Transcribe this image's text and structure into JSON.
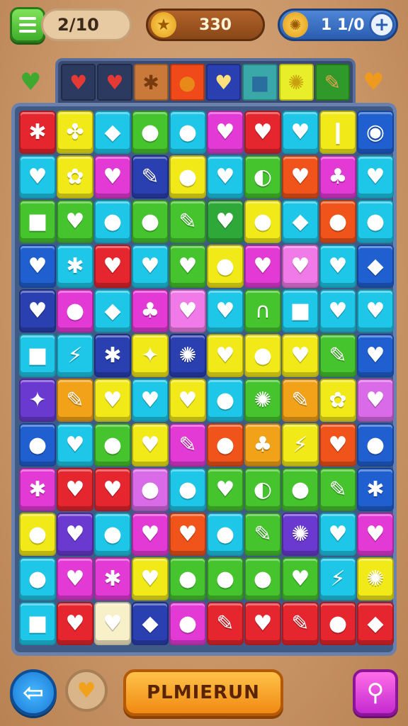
{
  "hud": {
    "moves": "2/10",
    "score": "330",
    "coins": "1 1/0",
    "star_glyph": "★",
    "coin_glyph": "✺",
    "plus_glyph": "+"
  },
  "goals": {
    "left_glyph": "♥",
    "right_glyph": "♥",
    "slots": [
      {
        "glyph": "♥",
        "bg": "#2b3a5e",
        "fg": "#e53935"
      },
      {
        "glyph": "♥",
        "bg": "#2b3a5e",
        "fg": "#e53935"
      },
      {
        "glyph": "✱",
        "bg": "#c97a3a",
        "fg": "#7a3a10"
      },
      {
        "glyph": "●",
        "bg": "#f04a1a",
        "fg": "#e88a1a"
      },
      {
        "glyph": "♥",
        "bg": "#2a3fb0",
        "fg": "#ffe07a"
      },
      {
        "glyph": "■",
        "bg": "#3aa8a8",
        "fg": "#2a6ea0"
      },
      {
        "glyph": "✺",
        "bg": "#e8ef2a",
        "fg": "#c8a010"
      },
      {
        "glyph": "✎",
        "bg": "#2f9a2a",
        "fg": "#e8a050"
      }
    ]
  },
  "board": {
    "rows": [
      [
        [
          "#e5262e",
          "✱"
        ],
        [
          "#f2ea18",
          "✤"
        ],
        [
          "#1ec7e8",
          "◆"
        ],
        [
          "#45c42e",
          "●"
        ],
        [
          "#1ec7e8",
          "●"
        ],
        [
          "#e33ad6",
          "♥"
        ],
        [
          "#e5262e",
          "♥"
        ],
        [
          "#1ec7e8",
          "♥"
        ],
        [
          "#f2ea18",
          "❙"
        ],
        [
          "#1f5fd0",
          "◉"
        ]
      ],
      [
        [
          "#1ec7e8",
          "♥"
        ],
        [
          "#f2ea18",
          "✿"
        ],
        [
          "#e33ad6",
          "♥"
        ],
        [
          "#2a3fb0",
          "✎"
        ],
        [
          "#f2ea18",
          "●"
        ],
        [
          "#1ec7e8",
          "♥"
        ],
        [
          "#45c42e",
          "◐"
        ],
        [
          "#f0541a",
          "♥"
        ],
        [
          "#e33ad6",
          "♣"
        ],
        [
          "#1ec7e8",
          "♥"
        ]
      ],
      [
        [
          "#45c42e",
          "■"
        ],
        [
          "#45c42e",
          "♥"
        ],
        [
          "#1ec7e8",
          "●"
        ],
        [
          "#45c42e",
          "●"
        ],
        [
          "#45c42e",
          "✎"
        ],
        [
          "#2fa83a",
          "♥"
        ],
        [
          "#f2ea18",
          "●"
        ],
        [
          "#1ec7e8",
          "◆"
        ],
        [
          "#f0541a",
          "●"
        ],
        [
          "#1ec7e8",
          "●"
        ]
      ],
      [
        [
          "#1f5fd0",
          "♥"
        ],
        [
          "#1ec7e8",
          "✱"
        ],
        [
          "#e5262e",
          "♥"
        ],
        [
          "#1ec7e8",
          "♥"
        ],
        [
          "#45c42e",
          "♥"
        ],
        [
          "#f2ea18",
          "●"
        ],
        [
          "#e33ad6",
          "♥"
        ],
        [
          "#f07ae8",
          "♥"
        ],
        [
          "#1ec7e8",
          "♥"
        ],
        [
          "#1f5fd0",
          "◆"
        ]
      ],
      [
        [
          "#2a3fb0",
          "♥"
        ],
        [
          "#e33ad6",
          "●"
        ],
        [
          "#1ec7e8",
          "◆"
        ],
        [
          "#e33ad6",
          "♣"
        ],
        [
          "#f07ae8",
          "♥"
        ],
        [
          "#1ec7e8",
          "♥"
        ],
        [
          "#45c42e",
          "∩"
        ],
        [
          "#1ec7e8",
          "■"
        ],
        [
          "#1ec7e8",
          "♥"
        ],
        [
          "#1ec7e8",
          "♥"
        ]
      ],
      [
        [
          "#1ec7e8",
          "■"
        ],
        [
          "#1ec7e8",
          "⚡"
        ],
        [
          "#2a3fb0",
          "✱"
        ],
        [
          "#f2ea18",
          "✦"
        ],
        [
          "#2a3fb0",
          "✺"
        ],
        [
          "#f2ea18",
          "♥"
        ],
        [
          "#f2ea18",
          "●"
        ],
        [
          "#f2ea18",
          "♥"
        ],
        [
          "#45c42e",
          "✎"
        ],
        [
          "#1f5fd0",
          "♥"
        ]
      ],
      [
        [
          "#6a3ad0",
          "✦"
        ],
        [
          "#f2a218",
          "✎"
        ],
        [
          "#f2ea18",
          "♥"
        ],
        [
          "#1ec7e8",
          "♥"
        ],
        [
          "#f2ea18",
          "♥"
        ],
        [
          "#1ec7e8",
          "●"
        ],
        [
          "#45c42e",
          "✺"
        ],
        [
          "#f2a218",
          "✎"
        ],
        [
          "#f2ea18",
          "✿"
        ],
        [
          "#d96ae8",
          "♥"
        ]
      ],
      [
        [
          "#1f5fd0",
          "●"
        ],
        [
          "#1ec7e8",
          "♥"
        ],
        [
          "#45c42e",
          "●"
        ],
        [
          "#f2ea18",
          "♥"
        ],
        [
          "#e33ad6",
          "✎"
        ],
        [
          "#f0541a",
          "●"
        ],
        [
          "#f2a218",
          "♣"
        ],
        [
          "#f2ea18",
          "⚡"
        ],
        [
          "#f0541a",
          "♥"
        ],
        [
          "#1f5fd0",
          "●"
        ]
      ],
      [
        [
          "#e33ad6",
          "✱"
        ],
        [
          "#e5262e",
          "♥"
        ],
        [
          "#e5262e",
          "♥"
        ],
        [
          "#d96ae8",
          "●"
        ],
        [
          "#1ec7e8",
          "●"
        ],
        [
          "#45c42e",
          "♥"
        ],
        [
          "#45c42e",
          "◐"
        ],
        [
          "#45c42e",
          "●"
        ],
        [
          "#45c42e",
          "✎"
        ],
        [
          "#1f5fd0",
          "✱"
        ]
      ],
      [
        [
          "#f2ea18",
          "●"
        ],
        [
          "#6a3ad0",
          "♥"
        ],
        [
          "#1ec7e8",
          "●"
        ],
        [
          "#e33ad6",
          "♥"
        ],
        [
          "#f0541a",
          "♥"
        ],
        [
          "#1ec7e8",
          "●"
        ],
        [
          "#45c42e",
          "✎"
        ],
        [
          "#6a3ad0",
          "✺"
        ],
        [
          "#1ec7e8",
          "♥"
        ],
        [
          "#e33ad6",
          "♥"
        ]
      ],
      [
        [
          "#1ec7e8",
          "●"
        ],
        [
          "#e33ad6",
          "♥"
        ],
        [
          "#e33ad6",
          "✱"
        ],
        [
          "#f2ea18",
          "♥"
        ],
        [
          "#45c42e",
          "●"
        ],
        [
          "#45c42e",
          "●"
        ],
        [
          "#45c42e",
          "●"
        ],
        [
          "#45c42e",
          "♥"
        ],
        [
          "#1ec7e8",
          "⚡"
        ],
        [
          "#f2ea18",
          "✺"
        ]
      ],
      [
        [
          "#1ec7e8",
          "■"
        ],
        [
          "#e5262e",
          "♥"
        ],
        [
          "#f8f0c8",
          "♥"
        ],
        [
          "#2a3fb0",
          "◆"
        ],
        [
          "#e33ad6",
          "●"
        ],
        [
          "#e5262e",
          "✎"
        ],
        [
          "#e5262e",
          "♥"
        ],
        [
          "#e5262e",
          "✎"
        ],
        [
          "#e5262e",
          "●"
        ],
        [
          "#e5262e",
          "◆"
        ]
      ]
    ]
  },
  "footer": {
    "back_glyph": "⇦",
    "heart_glyph": "♥",
    "play_label": "PLMIERUN",
    "search_glyph": "⚲"
  }
}
